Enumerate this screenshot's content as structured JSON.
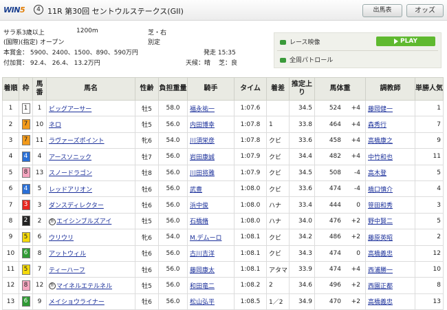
{
  "header": {
    "logo_text": "WIN",
    "logo_five": "5",
    "leg_number": "4",
    "race_title": "11R 第30回 セントウルステークス(GII)",
    "buttons": {
      "entry": "出馬表",
      "odds": "オッズ"
    }
  },
  "race_info": {
    "condition": "サラ系3歳以上",
    "distance": "1200m",
    "course": "芝・右",
    "class": "(国際)(指定) オープン",
    "weight_rule": "別定",
    "prize": "本賞金： 5900、2400、1500、890、590万円",
    "post_time": "発走 15:35",
    "added_money": "付加賞： 92.4、 26.4、 13.2万円",
    "weather": "天候：晴",
    "going": "芝：良"
  },
  "media": {
    "race_video": "レース映像",
    "patrol": "全周パトロール",
    "play_label": "PLAY"
  },
  "table": {
    "headers": [
      "着順",
      "枠",
      "馬番",
      "馬名",
      "性齢",
      "負担重量",
      "騎手",
      "タイム",
      "着差",
      "推定上り",
      "馬体重",
      "調教師",
      "単勝人気"
    ],
    "rows": [
      {
        "pos": "1",
        "waku": "1",
        "num": "1",
        "name": "ビッグアーサー",
        "sa": "牡5",
        "wt": "58.0",
        "jockey": "福永祐一",
        "time": "1:07.6",
        "margin": "",
        "last3f": "34.5",
        "bw": "524",
        "bwd": "+4",
        "trainer": "藤岡健一",
        "pop": "1"
      },
      {
        "pos": "2",
        "waku": "7",
        "num": "10",
        "name": "ネロ",
        "sa": "牡5",
        "wt": "56.0",
        "jockey": "内田博幸",
        "time": "1:07.8",
        "margin": "1",
        "last3f": "33.8",
        "bw": "464",
        "bwd": "+4",
        "trainer": "森秀行",
        "pop": "7"
      },
      {
        "pos": "3",
        "waku": "7",
        "num": "11",
        "name": "ラヴァーズポイント",
        "sa": "牝6",
        "wt": "54.0",
        "jockey": "川須栄彦",
        "time": "1:07.8",
        "margin": "クビ",
        "last3f": "33.6",
        "bw": "458",
        "bwd": "+4",
        "trainer": "高橋康之",
        "pop": "9"
      },
      {
        "pos": "4",
        "waku": "4",
        "num": "4",
        "name": "アースソニック",
        "sa": "牡7",
        "wt": "56.0",
        "jockey": "岩田康誠",
        "time": "1:07.9",
        "margin": "クビ",
        "last3f": "34.4",
        "bw": "482",
        "bwd": "+4",
        "trainer": "中竹和也",
        "pop": "11"
      },
      {
        "pos": "5",
        "waku": "8",
        "num": "13",
        "name": "スノードラゴン",
        "sa": "牡8",
        "wt": "56.0",
        "jockey": "川田将雅",
        "time": "1:07.9",
        "margin": "クビ",
        "last3f": "34.5",
        "bw": "508",
        "bwd": "-4",
        "trainer": "高木登",
        "pop": "5"
      },
      {
        "pos": "6",
        "waku": "4",
        "num": "5",
        "name": "レッドアリオン",
        "sa": "牡6",
        "wt": "56.0",
        "jockey": "武豊",
        "time": "1:08.0",
        "margin": "クビ",
        "last3f": "33.6",
        "bw": "474",
        "bwd": "-4",
        "trainer": "橋口慎介",
        "pop": "4"
      },
      {
        "pos": "7",
        "waku": "3",
        "num": "3",
        "name": "ダンスディレクター",
        "sa": "牡6",
        "wt": "56.0",
        "jockey": "浜中俊",
        "time": "1:08.0",
        "margin": "ハナ",
        "last3f": "33.4",
        "bw": "444",
        "bwd": "0",
        "trainer": "笹田和秀",
        "pop": "3"
      },
      {
        "pos": "8",
        "waku": "2",
        "num": "2",
        "name": "エイシンブルズアイ",
        "mark": "外",
        "sa": "牡5",
        "wt": "56.0",
        "jockey": "石橋脩",
        "time": "1:08.0",
        "margin": "ハナ",
        "last3f": "34.0",
        "bw": "476",
        "bwd": "+2",
        "trainer": "野中賢二",
        "pop": "5"
      },
      {
        "pos": "9",
        "waku": "5",
        "num": "6",
        "name": "ウリウリ",
        "sa": "牝6",
        "wt": "54.0",
        "jockey": "M.デムーロ",
        "time": "1:08.1",
        "margin": "クビ",
        "last3f": "34.2",
        "bw": "486",
        "bwd": "+2",
        "trainer": "藤原英昭",
        "pop": "2"
      },
      {
        "pos": "10",
        "waku": "6",
        "num": "8",
        "name": "アットウィル",
        "sa": "牡6",
        "wt": "56.0",
        "jockey": "古川吉洋",
        "time": "1:08.1",
        "margin": "クビ",
        "last3f": "34.3",
        "bw": "474",
        "bwd": "0",
        "trainer": "高橋義忠",
        "pop": "12"
      },
      {
        "pos": "11",
        "waku": "5",
        "num": "7",
        "name": "ティーハーフ",
        "sa": "牡6",
        "wt": "56.0",
        "jockey": "藤岡康太",
        "time": "1:08.1",
        "margin": "アタマ",
        "last3f": "33.9",
        "bw": "474",
        "bwd": "+4",
        "trainer": "西浦勝一",
        "pop": "10"
      },
      {
        "pos": "12",
        "waku": "8",
        "num": "12",
        "name": "マイネルエテルネル",
        "mark": "外",
        "sa": "牡5",
        "wt": "56.0",
        "jockey": "和田竜二",
        "time": "1:08.2",
        "margin": "2",
        "last3f": "34.6",
        "bw": "496",
        "bwd": "+2",
        "trainer": "西園正都",
        "pop": "8"
      },
      {
        "pos": "13",
        "waku": "6",
        "num": "9",
        "name": "メイショウライナー",
        "sa": "牡6",
        "wt": "56.0",
        "jockey": "松山弘平",
        "time": "1:08.5",
        "margin": "1／2",
        "last3f": "34.9",
        "bw": "470",
        "bwd": "+2",
        "trainer": "高橋義忠",
        "pop": "13"
      }
    ]
  },
  "colors": {
    "waku1": "#ffffff",
    "waku2": "#222222",
    "waku3": "#e8261f",
    "waku4": "#2a6fd6",
    "waku5": "#f4d90a",
    "waku6": "#2f9a34",
    "waku7": "#f29a1b",
    "waku8": "#f6a6c0",
    "link": "#1a2f9a",
    "header_bg": "#e9eae3",
    "play_button": "#5fb92f"
  }
}
